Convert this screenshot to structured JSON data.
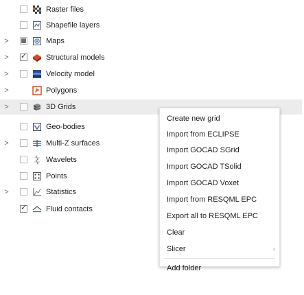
{
  "tree": {
    "items": [
      {
        "label": "Raster files",
        "check": "empty",
        "expand": false,
        "icon": "raster-icon"
      },
      {
        "label": "Shapefile layers",
        "check": "empty",
        "expand": false,
        "icon": "shapefile-icon"
      },
      {
        "label": "Maps",
        "check": "partial",
        "expand": true,
        "icon": "map-icon"
      },
      {
        "label": "Structural models",
        "check": "checked",
        "expand": true,
        "icon": "structural-model-icon"
      },
      {
        "label": "Velocity model",
        "check": "empty",
        "expand": true,
        "icon": "velocity-model-icon"
      },
      {
        "label": "Polygons",
        "check": "none",
        "expand": true,
        "icon": "polygon-icon"
      },
      {
        "label": "3D Grids",
        "check": "empty",
        "expand": true,
        "icon": "grid-3d-icon",
        "selected": true
      },
      {
        "label": "Geo-bodies",
        "check": "empty",
        "expand": false,
        "icon": "geobody-icon"
      },
      {
        "label": "Multi-Z surfaces",
        "check": "empty",
        "expand": true,
        "icon": "multiz-surface-icon"
      },
      {
        "label": "Wavelets",
        "check": "empty",
        "expand": false,
        "icon": "wavelet-icon"
      },
      {
        "label": "Points",
        "check": "empty",
        "expand": false,
        "icon": "points-icon"
      },
      {
        "label": "Statistics",
        "check": "empty",
        "expand": true,
        "icon": "statistics-icon"
      },
      {
        "label": "Fluid contacts",
        "check": "checked",
        "expand": false,
        "icon": "fluid-contact-icon"
      }
    ]
  },
  "context_menu": {
    "items": [
      {
        "label": "Create new grid"
      },
      {
        "label": "Import from ECLIPSE"
      },
      {
        "label": "Import GOCAD SGrid"
      },
      {
        "label": "Import GOCAD TSolid"
      },
      {
        "label": "Import GOCAD Voxet"
      },
      {
        "label": "Import from RESQML EPC"
      },
      {
        "label": "Export all to RESQML EPC"
      },
      {
        "label": "Clear"
      },
      {
        "label": "Slicer",
        "submenu": true,
        "submenu_glyph": "›"
      },
      {
        "label": "Add folder",
        "separator_before": true
      }
    ]
  },
  "colors": {
    "selected_row": "#ececec",
    "menu_bg": "#ffffff",
    "text": "#1e1e1e"
  }
}
